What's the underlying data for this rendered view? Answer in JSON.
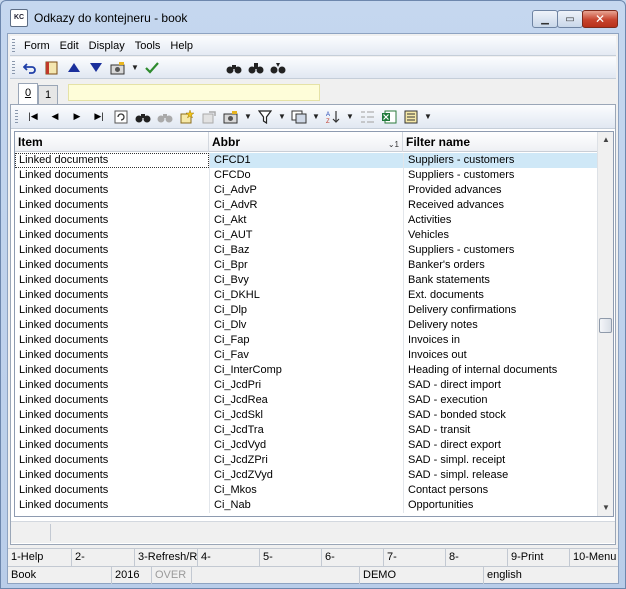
{
  "window": {
    "title": "Odkazy do kontejneru - book",
    "icon_text": "KC",
    "colors": {
      "selected_row": "#cfe8f7",
      "close_button": "#c7442e",
      "info_box": "#fefdd9"
    }
  },
  "menu": [
    "Form",
    "Edit",
    "Display",
    "Tools",
    "Help"
  ],
  "tabs": [
    "0",
    "1"
  ],
  "columns": {
    "item": "Item",
    "abbr": "Abbr",
    "filter": "Filter name",
    "abbr_sort": "⌄1"
  },
  "rows": [
    {
      "item": "Linked documents",
      "abbr": "CFCD1",
      "filter": "Suppliers - customers"
    },
    {
      "item": "Linked documents",
      "abbr": "CFCDo",
      "filter": "Suppliers - customers"
    },
    {
      "item": "Linked documents",
      "abbr": "Ci_AdvP",
      "filter": "Provided advances"
    },
    {
      "item": "Linked documents",
      "abbr": "Ci_AdvR",
      "filter": "Received advances"
    },
    {
      "item": "Linked documents",
      "abbr": "Ci_Akt",
      "filter": "Activities"
    },
    {
      "item": "Linked documents",
      "abbr": "Ci_AUT",
      "filter": "Vehicles"
    },
    {
      "item": "Linked documents",
      "abbr": "Ci_Baz",
      "filter": "Suppliers - customers"
    },
    {
      "item": "Linked documents",
      "abbr": "Ci_Bpr",
      "filter": "Banker's orders"
    },
    {
      "item": "Linked documents",
      "abbr": "Ci_Bvy",
      "filter": "Bank statements"
    },
    {
      "item": "Linked documents",
      "abbr": "Ci_DKHL",
      "filter": "Ext. documents"
    },
    {
      "item": "Linked documents",
      "abbr": "Ci_Dlp",
      "filter": "Delivery confirmations"
    },
    {
      "item": "Linked documents",
      "abbr": "Ci_Dlv",
      "filter": "Delivery notes"
    },
    {
      "item": "Linked documents",
      "abbr": "Ci_Fap",
      "filter": "Invoices in"
    },
    {
      "item": "Linked documents",
      "abbr": "Ci_Fav",
      "filter": "Invoices out"
    },
    {
      "item": "Linked documents",
      "abbr": "Ci_InterComp",
      "filter": "Heading of internal documents"
    },
    {
      "item": "Linked documents",
      "abbr": "Ci_JcdPri",
      "filter": "SAD - direct import"
    },
    {
      "item": "Linked documents",
      "abbr": "Ci_JcdRea",
      "filter": "SAD - execution"
    },
    {
      "item": "Linked documents",
      "abbr": "Ci_JcdSkl",
      "filter": "SAD - bonded stock"
    },
    {
      "item": "Linked documents",
      "abbr": "Ci_JcdTra",
      "filter": "SAD - transit"
    },
    {
      "item": "Linked documents",
      "abbr": "Ci_JcdVyd",
      "filter": "SAD - direct export"
    },
    {
      "item": "Linked documents",
      "abbr": "Ci_JcdZPri",
      "filter": "SAD - simpl. receipt"
    },
    {
      "item": "Linked documents",
      "abbr": "Ci_JcdZVyd",
      "filter": "SAD - simpl. release"
    },
    {
      "item": "Linked documents",
      "abbr": "Ci_Mkos",
      "filter": "Contact persons"
    },
    {
      "item": "Linked documents",
      "abbr": "Ci_Nab",
      "filter": "Opportunities"
    }
  ],
  "fkeys": [
    "1-Help",
    "2-",
    "3-Refresh/R",
    "4-",
    "5-",
    "6-",
    "7-",
    "8-",
    "9-Print",
    "10-Menu"
  ],
  "status": {
    "book": "Book",
    "year": "2016",
    "mode": "OVER",
    "db": "DEMO",
    "lang": "english"
  }
}
